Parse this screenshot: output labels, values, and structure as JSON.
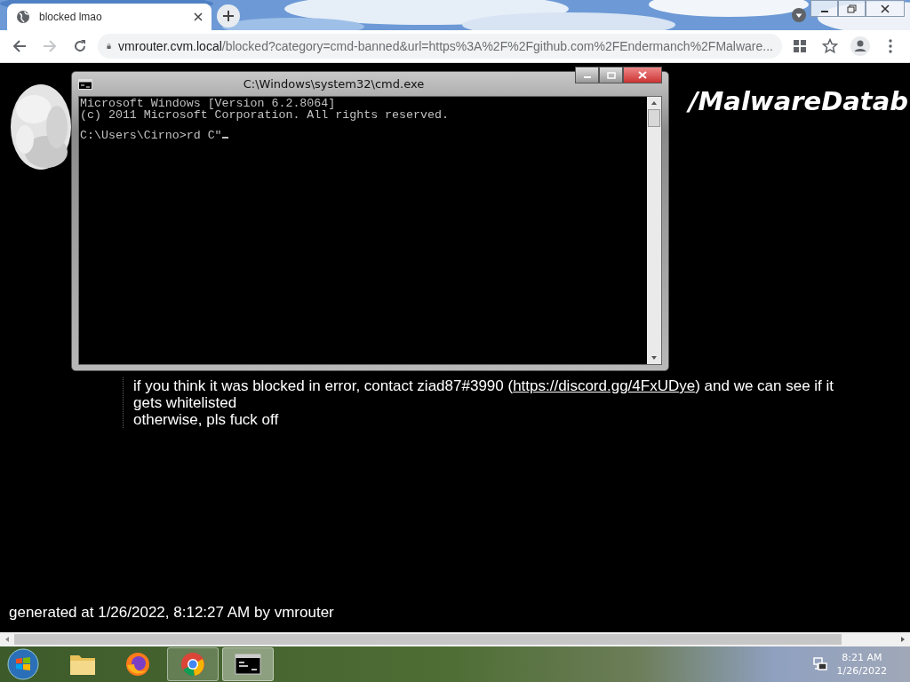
{
  "browser": {
    "tabs": [
      {
        "title": "blocked lmao",
        "selected": true
      }
    ],
    "address": {
      "host": "vmrouter.cvm.local",
      "path": "/blocked?category=cmd-banned&url=https%3A%2F%2Fgithub.com%2FEndermanch%2FMalware..."
    },
    "forward_disabled": true
  },
  "page": {
    "heading": "/MalwareDatab",
    "message": {
      "before": "if you think it was blocked in error, contact ziad87#3990 (",
      "link": "https://discord.gg/4FxUDye",
      "after": ") and we can see if it gets whitelisted",
      "line2": "otherwise, pls fuck off"
    },
    "footer": "generated at 1/26/2022, 8:12:27 AM by vmrouter"
  },
  "console": {
    "title": "C:\\Windows\\system32\\cmd.exe",
    "lines": [
      "Microsoft Windows [Version 6.2.8064]",
      "(c) 2011 Microsoft Corporation. All rights reserved."
    ],
    "prompt": "C:\\Users\\Cirno>rd C\""
  },
  "taskbar": {
    "apps": [
      {
        "kind": "explorer",
        "running": false,
        "focused": false
      },
      {
        "kind": "firefox",
        "running": false,
        "focused": false
      },
      {
        "kind": "chrome",
        "running": true,
        "focused": false
      },
      {
        "kind": "cmd",
        "running": true,
        "focused": true
      }
    ],
    "time": "8:21 AM",
    "date": "1/26/2022"
  }
}
